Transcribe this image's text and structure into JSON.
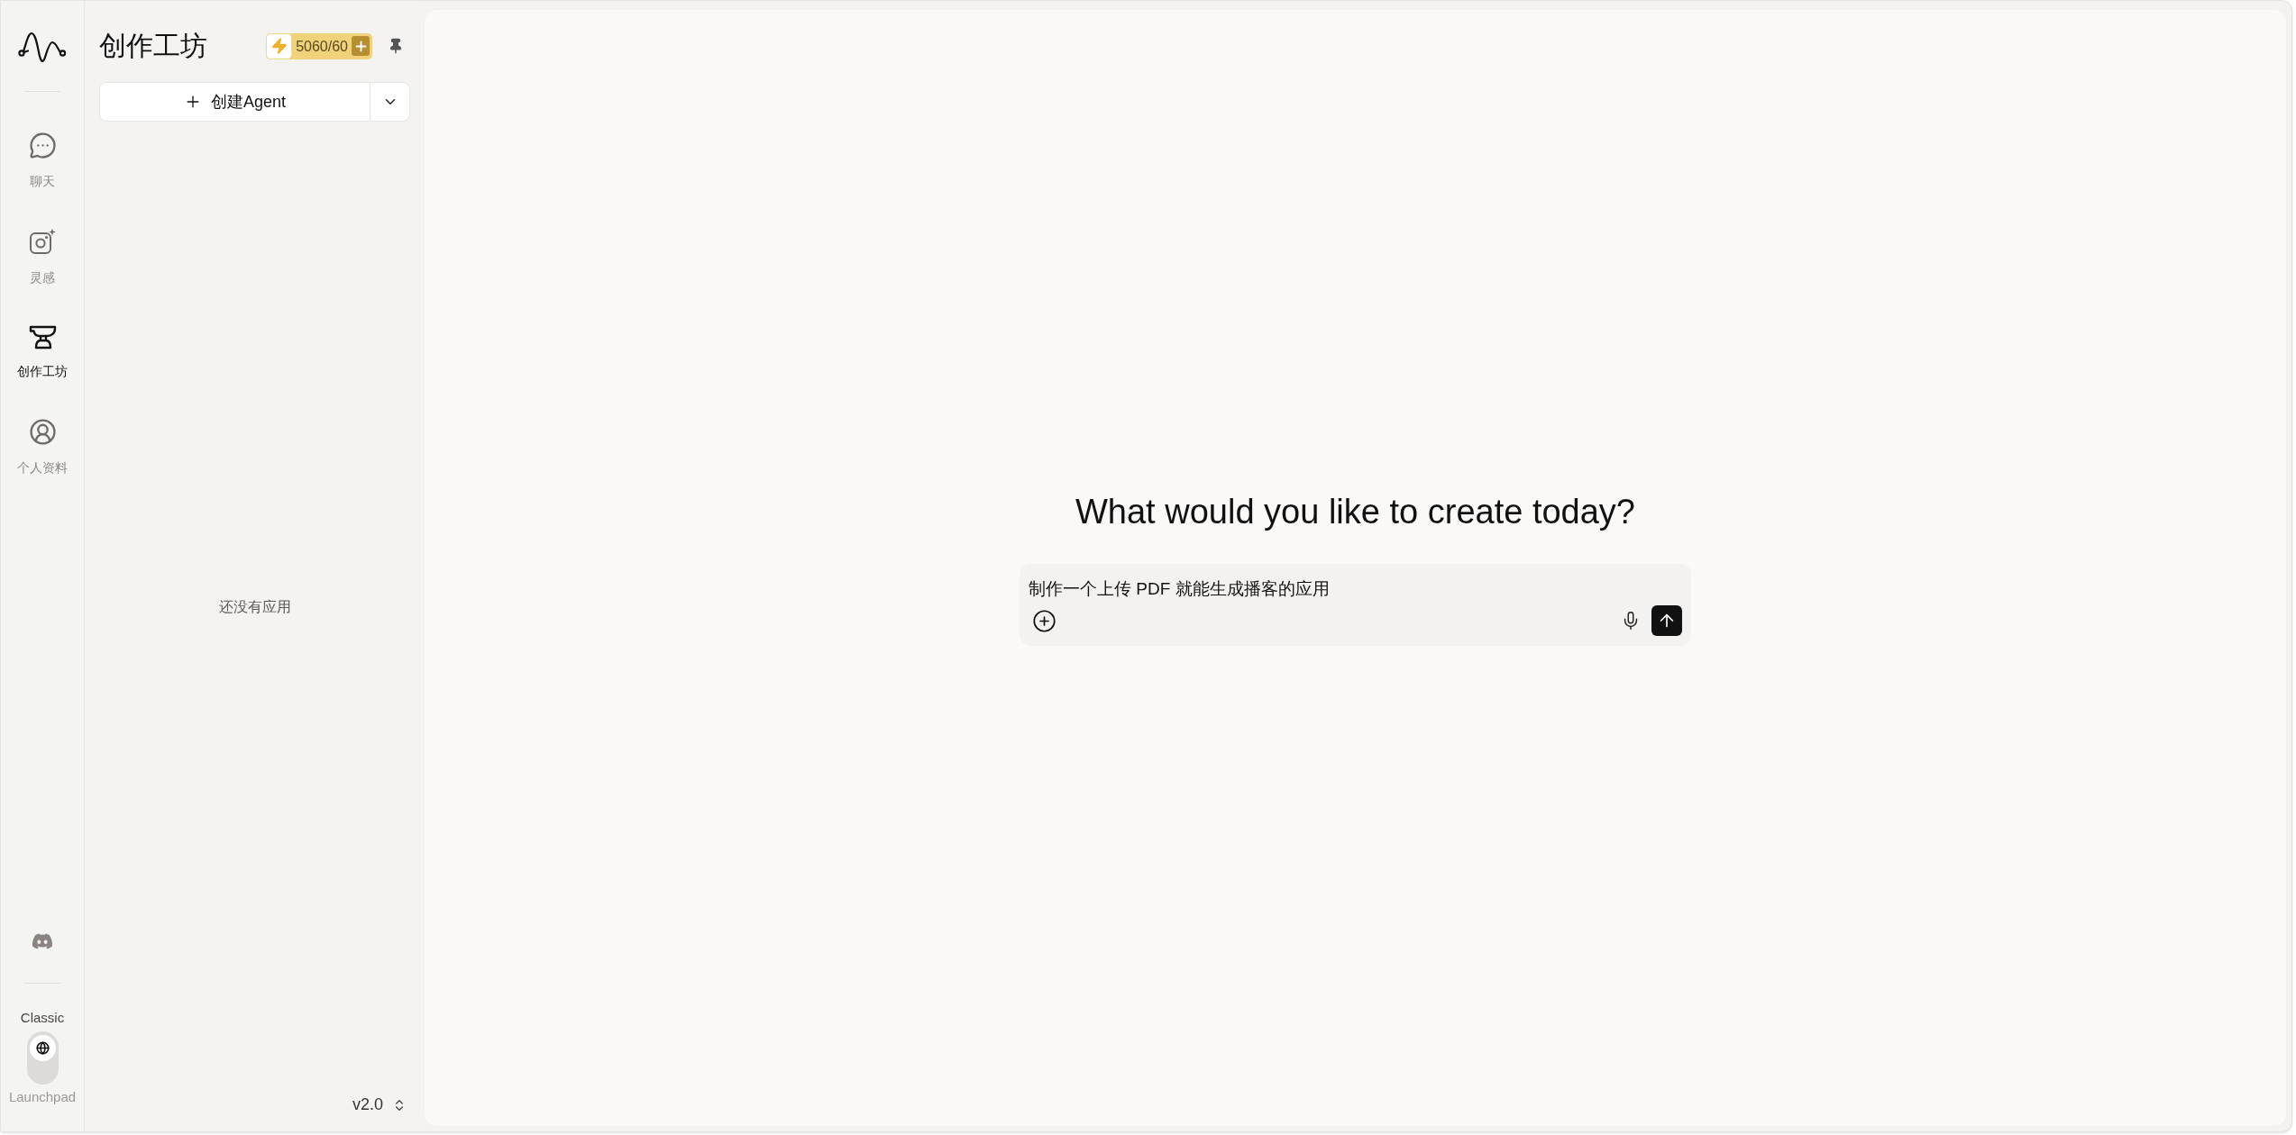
{
  "rail": {
    "nav": [
      {
        "label": "聊天",
        "selected": false
      },
      {
        "label": "灵感",
        "selected": false
      },
      {
        "label": "创作工坊",
        "selected": true
      },
      {
        "label": "个人资料",
        "selected": false
      }
    ],
    "mode_switch": {
      "options": [
        {
          "label": "Classic",
          "selected": true
        },
        {
          "label": "Launchpad",
          "selected": false
        }
      ]
    }
  },
  "sidebar": {
    "title": "创作工坊",
    "credits": "5060/60",
    "create_button": "创建Agent",
    "empty_text": "还没有应用",
    "version": "v2.0"
  },
  "main": {
    "heading": "What would you like to create today?",
    "prompt": {
      "value": "制作一个上传 PDF 就能生成播客的应用"
    }
  }
}
